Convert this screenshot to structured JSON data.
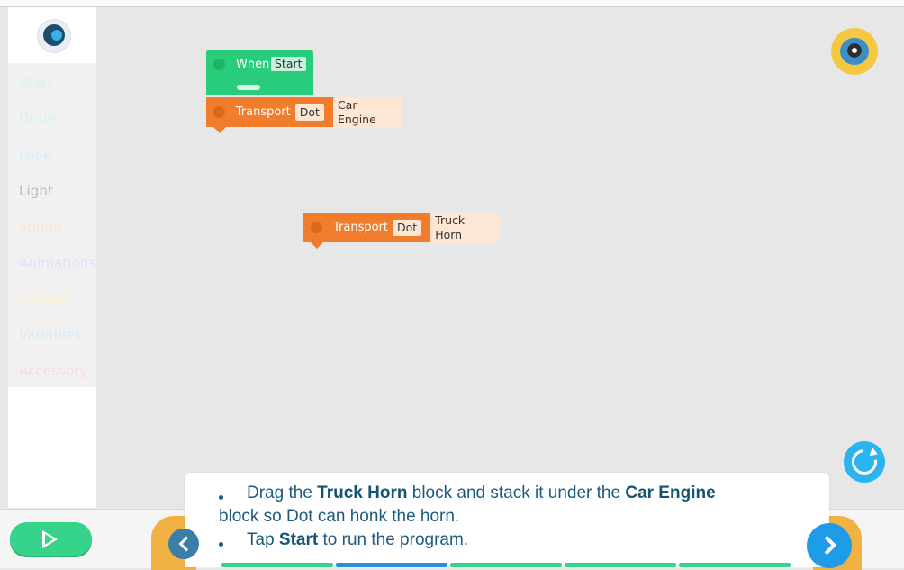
{
  "sidebar": {
    "logo_icon": "wonder-app-logo-icon",
    "categories": [
      {
        "label": "Start",
        "color": "#d5f5e3"
      },
      {
        "label": "Drive",
        "color": "#d4f3ee"
      },
      {
        "label": "Look",
        "color": "#d4f0f8"
      },
      {
        "label": "Light",
        "color": "#bdbdbd"
      },
      {
        "label": "Sound",
        "color": "#fde3d0"
      },
      {
        "label": "Animations",
        "color": "#e6dcf6"
      },
      {
        "label": "Control",
        "color": "#fbf1cb"
      },
      {
        "label": "Variables",
        "color": "#d6eaf8"
      },
      {
        "label": "Accessory",
        "color": "#fbdbe3"
      }
    ]
  },
  "canvas": {
    "when_block": {
      "label": "When",
      "value": "Start",
      "color": "#29cc7a"
    },
    "blocks": [
      {
        "label": "Transport",
        "target": "Dot",
        "sound": "Car Engine",
        "color": "#f07c2c"
      },
      {
        "label": "Transport",
        "target": "Dot",
        "sound": "Truck Horn",
        "color": "#f07c2c"
      }
    ],
    "robot_icon": "dash-robot-icon",
    "reset_icon": "reset-icon"
  },
  "instructions": {
    "line1_a": "Drag the ",
    "line1_b": "Truck Horn",
    "line1_c": " block and stack it under the ",
    "line1_d": "Car Engine",
    "line2": "block so Dot can honk the horn.",
    "line3_a": "Tap ",
    "line3_b": "Start",
    "line3_c": " to run the program."
  },
  "controls": {
    "play_icon": "play-icon",
    "prev_icon": "chevron-left-icon",
    "next_icon": "chevron-right-icon"
  },
  "progress": {
    "segments": [
      "#36d38a",
      "#2a8fd6",
      "#36d38a",
      "#36d38a",
      "#36d38a"
    ]
  }
}
